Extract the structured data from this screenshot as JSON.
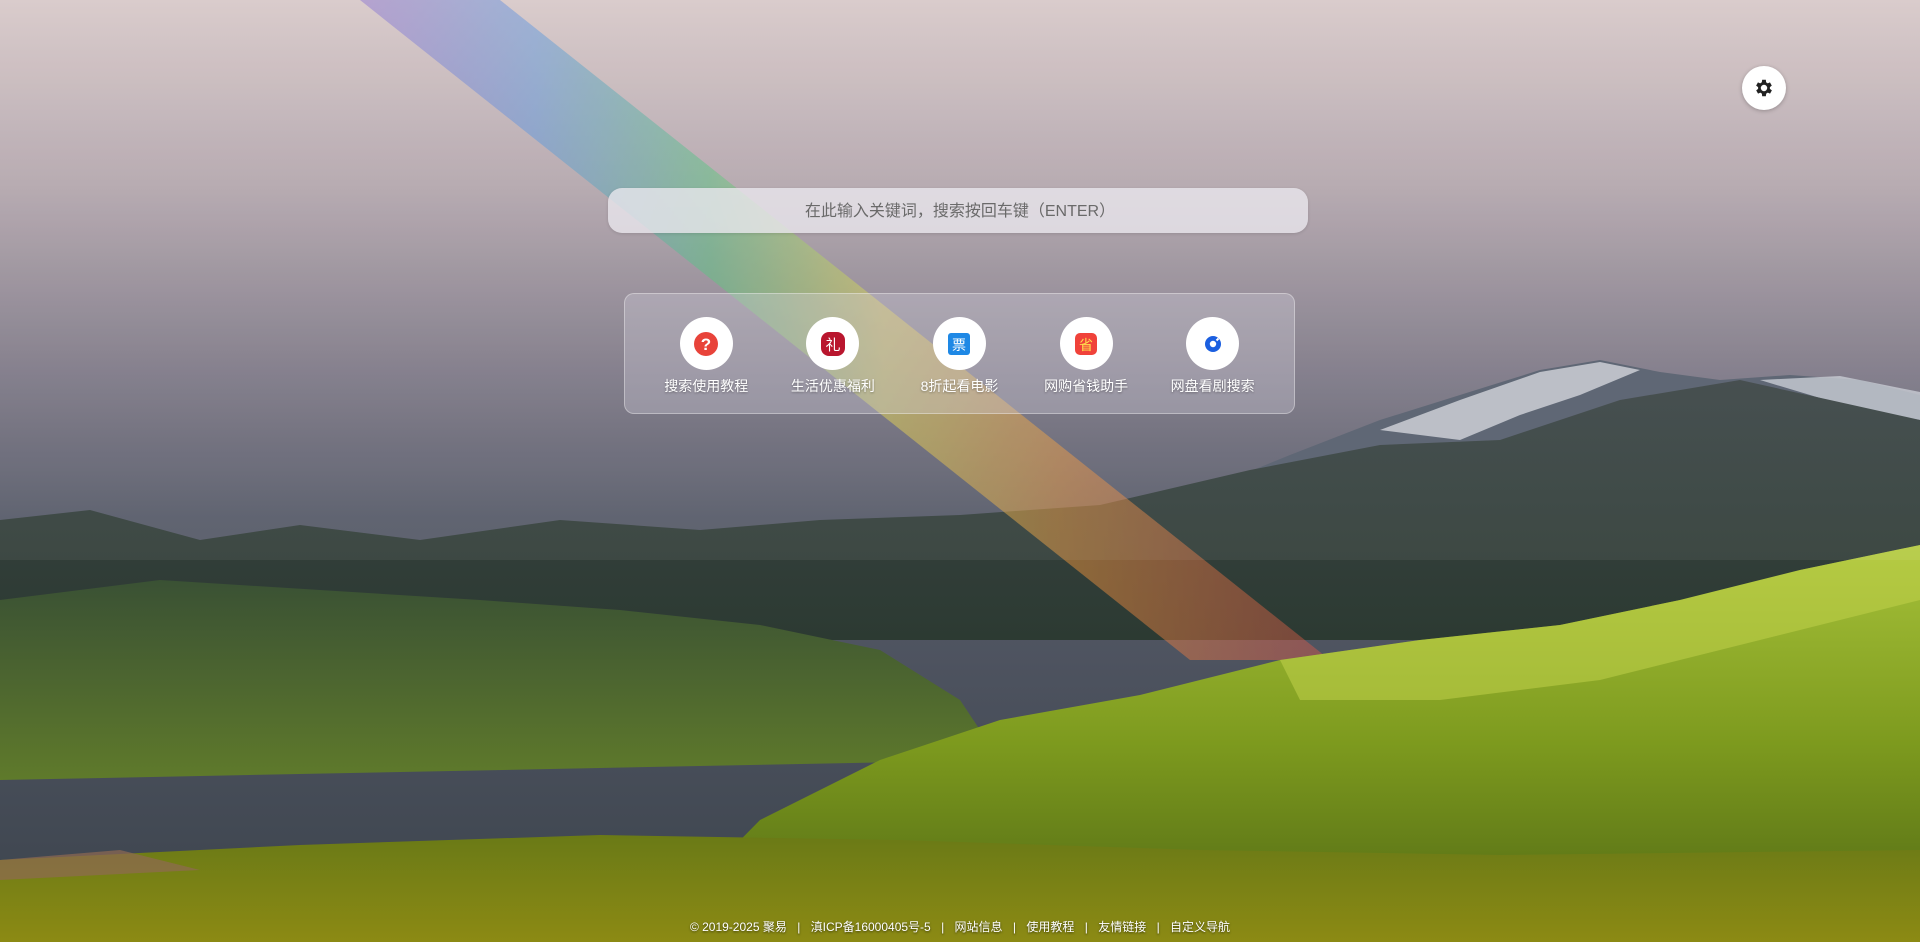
{
  "search": {
    "placeholder": "在此输入关键词，搜索按回车键（ENTER）"
  },
  "settings": {
    "icon": "gear-icon"
  },
  "quick_links": [
    {
      "label": "搜索使用教程",
      "icon": "question-icon",
      "color": "#e8433a",
      "glyph": "?"
    },
    {
      "label": "生活优惠福利",
      "icon": "gift-icon",
      "color": "#b9162e",
      "glyph": "礼"
    },
    {
      "label": "8折起看电影",
      "icon": "ticket-icon",
      "color": "#1e88e5",
      "glyph": "票"
    },
    {
      "label": "网购省钱助手",
      "icon": "coupon-icon",
      "color": "#f0423a",
      "glyph": "省"
    },
    {
      "label": "网盘看剧搜索",
      "icon": "cloud-drive-icon",
      "color": "#1b5fe0",
      "glyph": ""
    }
  ],
  "footer": {
    "copyright": "© 2019-2025 聚易",
    "icp": "滇ICP备16000405号-5",
    "links": [
      "网站信息",
      "使用教程",
      "友情链接",
      "自定义导航"
    ],
    "separator": "|"
  }
}
